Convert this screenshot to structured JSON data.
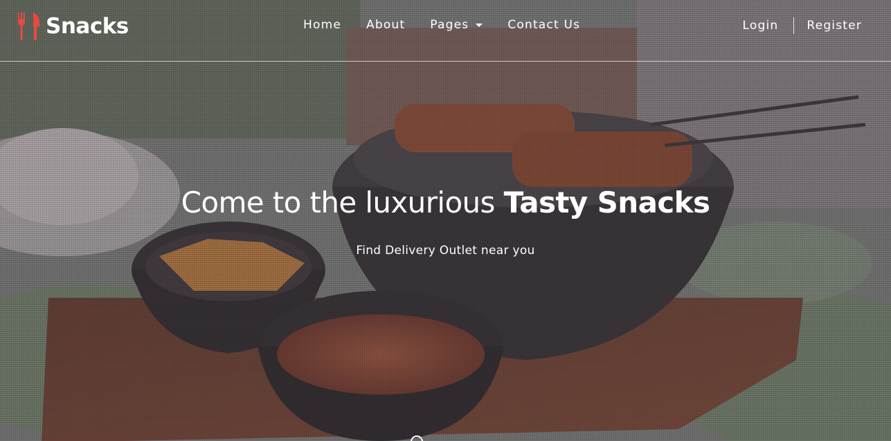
{
  "brand": {
    "name": "Snacks",
    "icon": "fork-knife-icon",
    "accent_color": "#e8493f"
  },
  "nav": {
    "items": [
      {
        "label": "Home"
      },
      {
        "label": "About"
      },
      {
        "label": "Pages",
        "has_dropdown": true
      },
      {
        "label": "Contact Us"
      }
    ],
    "auth": {
      "login": "Login",
      "register": "Register"
    }
  },
  "hero": {
    "title_regular": "Come to the luxurious ",
    "title_bold": "Tasty Snacks",
    "subtitle": "Find Delivery Outlet near you",
    "scroll_icon": "scroll-down-icon"
  }
}
